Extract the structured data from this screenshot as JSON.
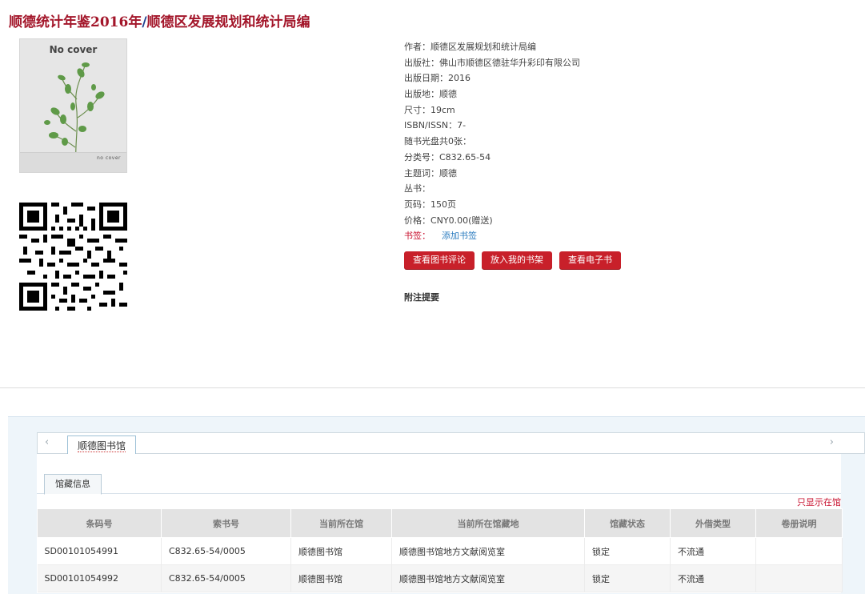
{
  "title": {
    "main": "顺德统计年鉴2016年",
    "slash": "/",
    "author": "顺德区发展规划和统计局编"
  },
  "cover": {
    "top_text": "No cover",
    "bottom_text": "no cover"
  },
  "meta": [
    {
      "key": "作者：",
      "value": "顺德区发展规划和统计局编"
    },
    {
      "key": "出版社：",
      "value": "佛山市顺德区德驻华升彩印有限公司"
    },
    {
      "key": "出版日期：",
      "value": "2016"
    },
    {
      "key": "出版地：",
      "value": "顺德"
    },
    {
      "key": "尺寸：",
      "value": "19cm"
    },
    {
      "key": "ISBN/ISSN：",
      "value": "7-"
    },
    {
      "key": "随书光盘共0张：",
      "value": ""
    },
    {
      "key": "分类号：",
      "value": "C832.65-54"
    },
    {
      "key": "主题词：",
      "value": "顺德"
    },
    {
      "key": "丛书：",
      "value": ""
    },
    {
      "key": "页码：",
      "value": "150页"
    },
    {
      "key": "价格：",
      "value": "CNY0.00(赠送)"
    }
  ],
  "bookmark": {
    "key": "书签：",
    "action": "添加书签"
  },
  "buttons": {
    "review": "查看图书评论",
    "shelf": "放入我的书架",
    "ebook": "查看电子书"
  },
  "note_heading": "附注提要",
  "holdings": {
    "library_tab": "顺德图书馆",
    "subtab": "馆藏信息",
    "only_show": "只显示在馆",
    "columns": [
      "条码号",
      "索书号",
      "当前所在馆",
      "当前所在馆藏地",
      "馆藏状态",
      "外借类型",
      "卷册说明"
    ],
    "rows": [
      [
        "SD00101054991",
        "C832.65-54/0005",
        "顺德图书馆",
        "顺德图书馆地方文献阅览室",
        "锁定",
        "不流通",
        ""
      ],
      [
        "SD00101054992",
        "C832.65-54/0005",
        "顺德图书馆",
        "顺德图书馆地方文献阅览室",
        "锁定",
        "不流通",
        ""
      ]
    ]
  },
  "colors": {
    "accent": "#c8202a",
    "title_red": "#a3162a",
    "link_blue": "#2a7bbf"
  },
  "icons": {
    "left_arrow": "chevron-left-icon",
    "right_arrow": "chevron-right-icon",
    "qr": "qr-code-icon"
  }
}
